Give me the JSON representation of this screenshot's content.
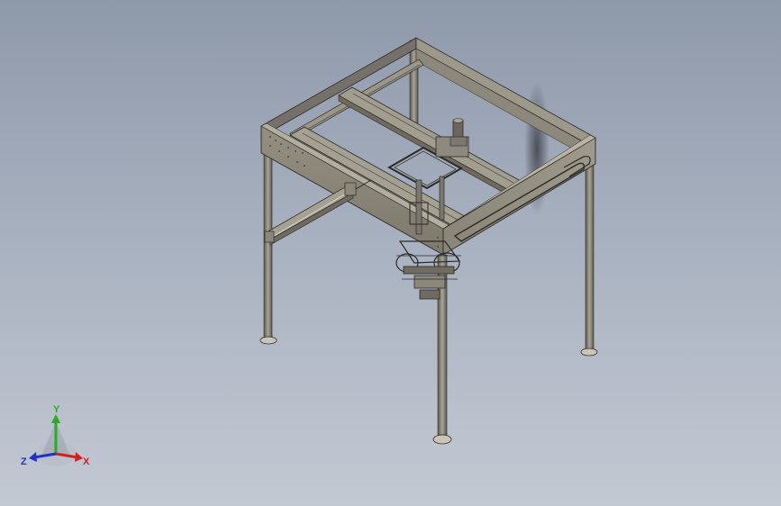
{
  "viewport": {
    "background_top": "#8e99aa",
    "background_bottom": "#c3c9d3",
    "model_color": "#8b877a",
    "model_dark": "#5f5c52",
    "model_edge": "#2b2a26"
  },
  "triad": {
    "x_label": "X",
    "y_label": "Y",
    "z_label": "Z",
    "x_color": "#d22020",
    "y_color": "#22b022",
    "z_color": "#2030d0"
  }
}
